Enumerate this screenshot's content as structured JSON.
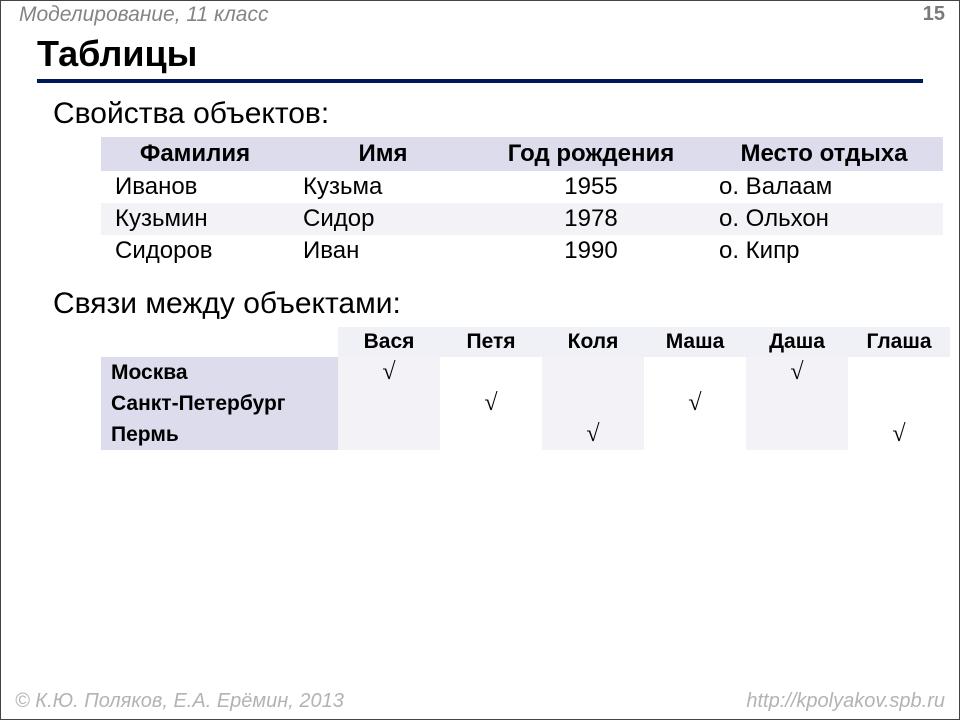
{
  "header": {
    "course": "Моделирование, 11 класс",
    "page": "15"
  },
  "title": "Таблицы",
  "section1": "Свойства объектов:",
  "table1": {
    "headers": {
      "c0": "Фамилия",
      "c1": "Имя",
      "c2": "Год рождения",
      "c3": "Место отдыха"
    },
    "rows": [
      {
        "c0": "Иванов",
        "c1": "Кузьма",
        "c2": "1955",
        "c3": "о. Валаам"
      },
      {
        "c0": "Кузьмин",
        "c1": "Сидор",
        "c2": "1978",
        "c3": "о. Ольхон"
      },
      {
        "c0": "Сидоров",
        "c1": "Иван",
        "c2": "1990",
        "c3": "о. Кипр"
      }
    ]
  },
  "section2": "Связи между объектами:",
  "table2": {
    "col_headers": [
      "Вася",
      "Петя",
      "Коля",
      "Маша",
      "Даша",
      "Глаша"
    ],
    "row_headers": [
      "Москва",
      "Санкт-Петербург",
      "Пермь"
    ],
    "mark": "√",
    "matrix": [
      [
        true,
        false,
        false,
        false,
        true,
        false
      ],
      [
        false,
        true,
        false,
        true,
        false,
        false
      ],
      [
        false,
        false,
        true,
        false,
        false,
        true
      ]
    ]
  },
  "footer": {
    "copyright_symbol": "©",
    "authors": " К.Ю. Поляков, Е.А. Ерёмин, 2013",
    "url": "http://kpolyakov.spb.ru"
  }
}
